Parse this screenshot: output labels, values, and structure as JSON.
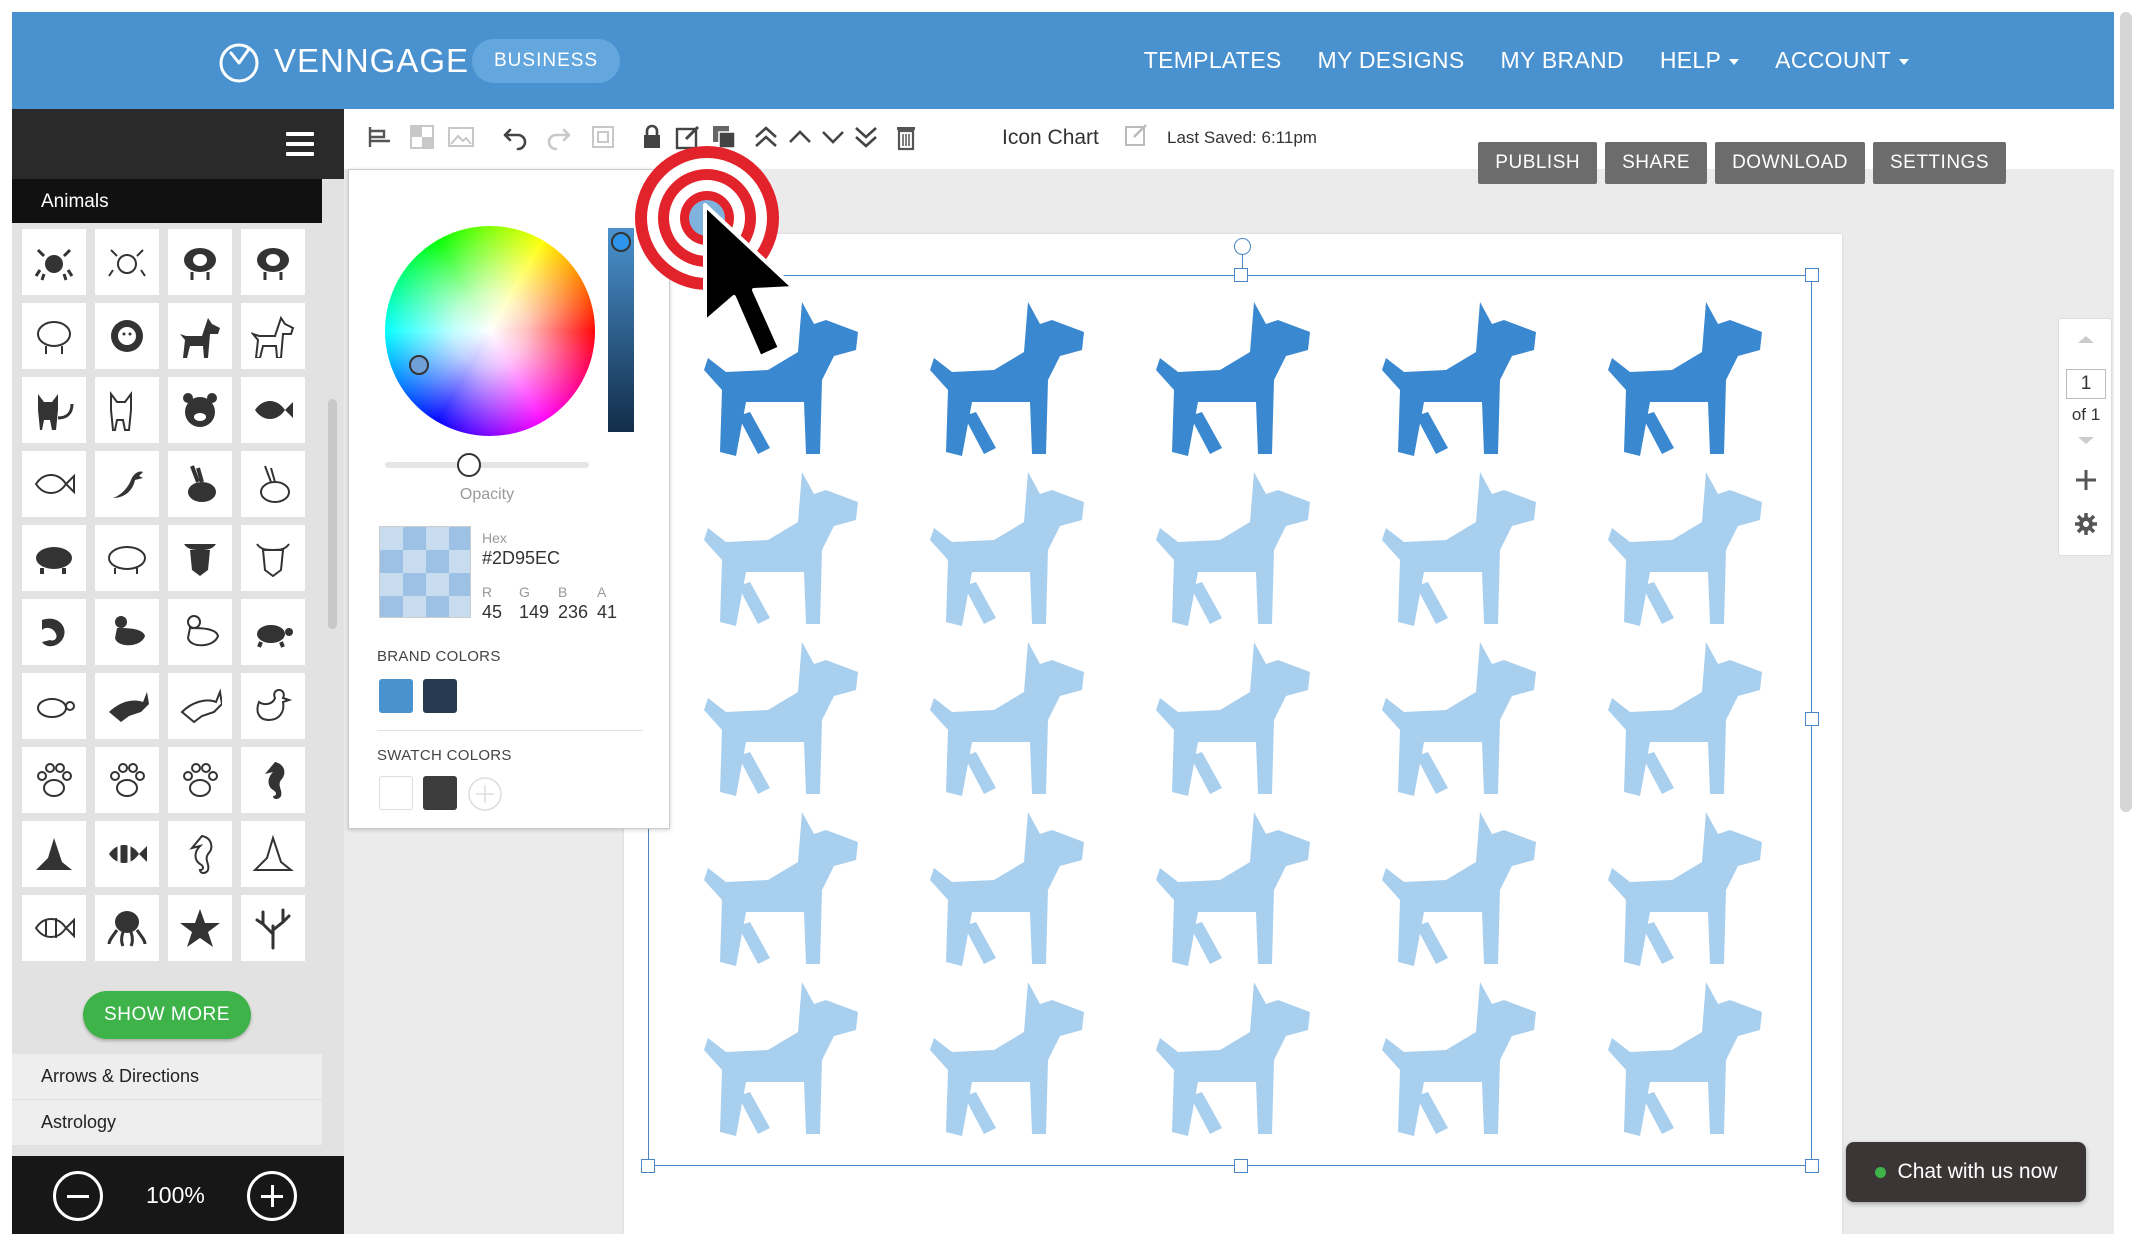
{
  "header": {
    "brand": "VENNGAGE",
    "plan_badge": "BUSINESS",
    "nav": [
      {
        "label": "TEMPLATES",
        "has_caret": false
      },
      {
        "label": "MY DESIGNS",
        "has_caret": false
      },
      {
        "label": "MY BRAND",
        "has_caret": false
      },
      {
        "label": "HELP",
        "has_caret": true
      },
      {
        "label": "ACCOUNT",
        "has_caret": true
      }
    ]
  },
  "sidebar": {
    "active_category": "Animals",
    "icons": [
      "crab",
      "crab-outline",
      "sheep",
      "sheep",
      "sheep-outline",
      "lion",
      "dog",
      "dog-outline",
      "cat",
      "cat-outline",
      "bear",
      "fish",
      "fish-outline",
      "bird",
      "rabbit",
      "rabbit-outline",
      "pig",
      "pig-outline",
      "cow",
      "cow-outline",
      "shrimp",
      "duck",
      "duck-outline",
      "turtle",
      "turtle-outline",
      "rabbit-running",
      "rabbit-running-outline",
      "chicken",
      "paw",
      "paw-outline",
      "paw-outline",
      "seahorse",
      "shark",
      "clownfish",
      "seahorse-outline",
      "shark-outline",
      "clownfish-outline",
      "octopus",
      "starfish",
      "coral"
    ],
    "show_more_label": "SHOW MORE",
    "categories": [
      "Arrows & Directions",
      "Astrology"
    ],
    "zoom_value": "100%"
  },
  "toolbar": {
    "doc_title": "Icon Chart",
    "last_saved": "Last Saved: 6:11pm",
    "actions": [
      "PUBLISH",
      "SHARE",
      "DOWNLOAD",
      "SETTINGS"
    ]
  },
  "color_picker": {
    "opacity_label": "Opacity",
    "opacity_value": 0.41,
    "hex_label": "Hex",
    "hex_value": "#2D95EC",
    "channels": [
      {
        "label": "R",
        "value": "45"
      },
      {
        "label": "G",
        "value": "149"
      },
      {
        "label": "B",
        "value": "236"
      },
      {
        "label": "A",
        "value": "41"
      }
    ],
    "brand_colors_label": "BRAND COLORS",
    "brand_colors": [
      "#4a92cf",
      "#263a4f"
    ],
    "swatch_colors_label": "SWATCH COLORS",
    "swatch_colors": [
      "#ffffff",
      "#3c3c3c"
    ]
  },
  "canvas": {
    "icon": "dog",
    "columns": 5,
    "rows": 5,
    "filled_count": 5,
    "filled_color": "#3a88cf",
    "faded_color": "#a9cfef"
  },
  "page_nav": {
    "current": "1",
    "total": "of 1"
  },
  "chat": {
    "label": "Chat with us now"
  }
}
